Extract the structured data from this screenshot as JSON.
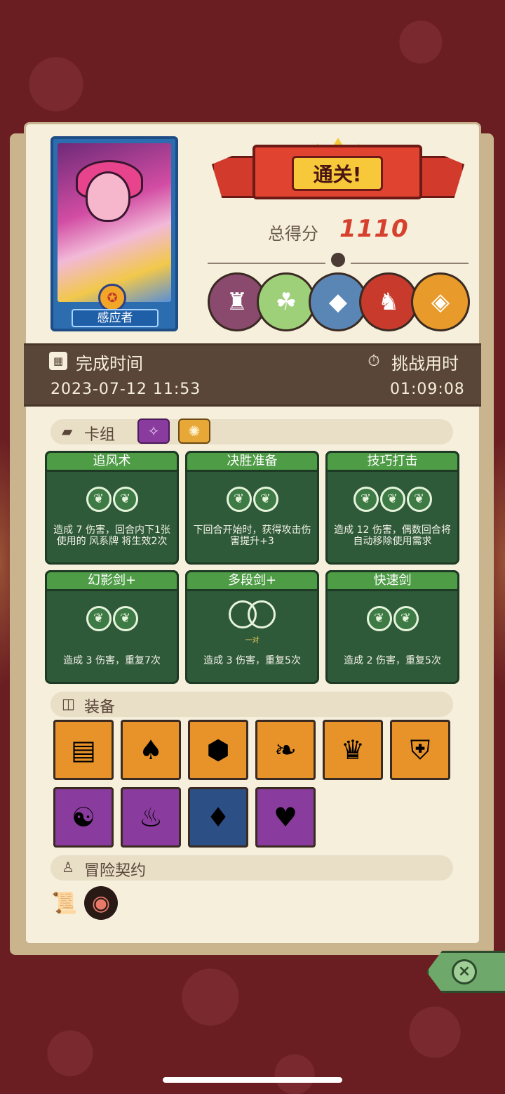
{
  "hero": {
    "name": "感应者"
  },
  "banner": {
    "title": "通关!"
  },
  "score": {
    "label": "总得分",
    "value": "1110"
  },
  "bosses": [
    {
      "icon": "stone-golem-icon"
    },
    {
      "icon": "green-beast-icon"
    },
    {
      "icon": "blue-shark-icon"
    },
    {
      "icon": "red-demon-icon"
    },
    {
      "icon": "crystal-beast-icon"
    }
  ],
  "times": {
    "finish_label": "完成时间",
    "finish_value": "2023-07-12 11:53",
    "challenge_label": "挑战用时",
    "challenge_value": "01:09:08"
  },
  "deck": {
    "title": "卡组",
    "cards": [
      {
        "title": "追风术",
        "energy": 2,
        "desc": "造成 7 伤害，回合内下1张使用的 风系牌 将生效2次"
      },
      {
        "title": "决胜准备",
        "energy": 2,
        "desc": "下回合开始时，获得攻击伤害提升+3"
      },
      {
        "title": "技巧打击",
        "energy": 3,
        "desc": "造成 12 伤害，偶数回合将自动移除使用需求"
      },
      {
        "title": "幻影剑+",
        "energy": 2,
        "desc": "造成 3 伤害，重复7次"
      },
      {
        "title": "多段剑+",
        "energy": 0,
        "pair": "一对",
        "desc": "造成 3 伤害，重复5次"
      },
      {
        "title": "快速剑",
        "energy": 2,
        "desc": "造成 2 伤害，重复5次"
      }
    ]
  },
  "equipment": {
    "title": "装备",
    "items": [
      {
        "icon": "moss-book-icon",
        "rarity": "orange"
      },
      {
        "icon": "dark-cloak-icon",
        "rarity": "orange"
      },
      {
        "icon": "turtle-shell-icon",
        "rarity": "orange"
      },
      {
        "icon": "green-feather-icon",
        "rarity": "orange"
      },
      {
        "icon": "sweater-icon",
        "rarity": "orange"
      },
      {
        "icon": "pumpkin-shield-icon",
        "rarity": "orange"
      },
      {
        "icon": "jade-mask-icon",
        "rarity": "purple"
      },
      {
        "icon": "fire-shield-icon",
        "rarity": "purple"
      },
      {
        "icon": "steel-armor-icon",
        "rarity": "blue"
      },
      {
        "icon": "red-robe-icon",
        "rarity": "purple"
      }
    ]
  },
  "contract": {
    "title": "冒险契约",
    "items": [
      {
        "icon": "scroll-icon"
      },
      {
        "icon": "meat-icon"
      }
    ]
  },
  "close": {
    "label": "×"
  }
}
